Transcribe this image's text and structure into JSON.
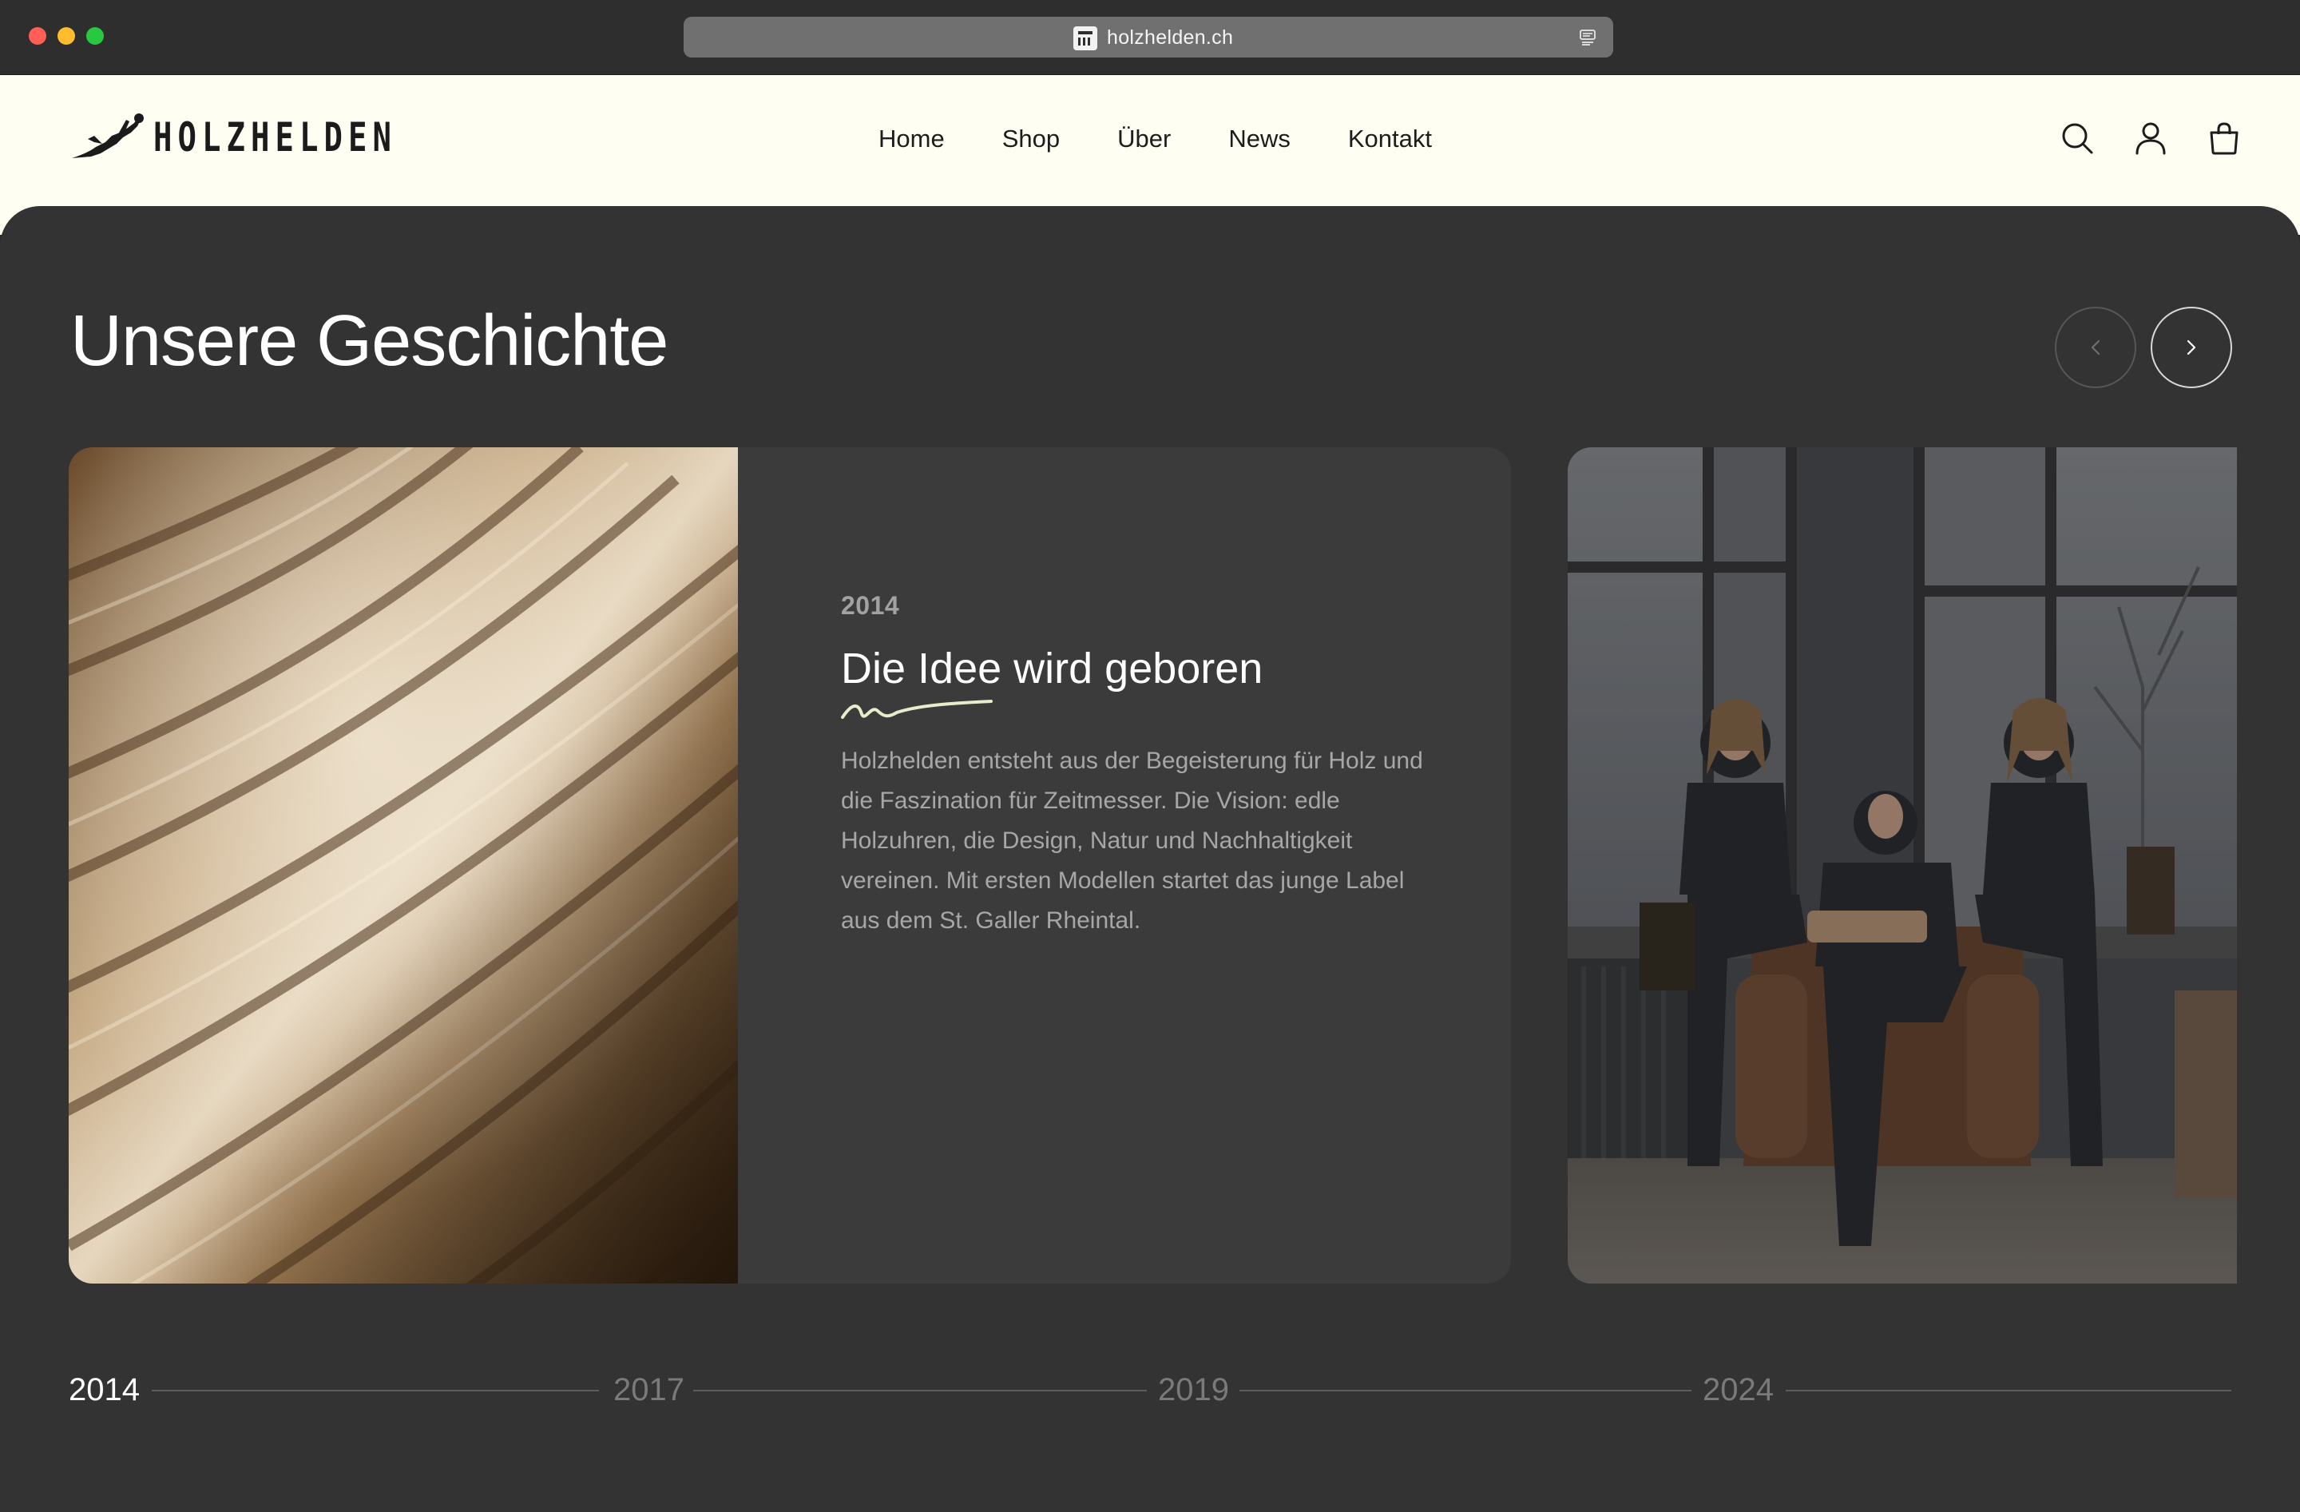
{
  "browser": {
    "url": "holzhelden.ch"
  },
  "header": {
    "logo_text": "HOLZHELDEN",
    "nav": [
      {
        "label": "Home"
      },
      {
        "label": "Shop"
      },
      {
        "label": "Über"
      },
      {
        "label": "News"
      },
      {
        "label": "Kontakt"
      }
    ],
    "icons": [
      "search-icon",
      "account-icon",
      "shopping-bag-icon"
    ]
  },
  "section": {
    "title": "Unsere Geschichte"
  },
  "slide": {
    "year": "2014",
    "heading_highlight": "Die Idee",
    "heading_rest": " wird geboren",
    "text": "Holzhelden entsteht aus der Begeisterung für Holz und die Faszination für Zeitmesser. Die Vision: edle Holzuhren, die Design, Natur und Nachhaltigkeit vereinen. Mit ersten Modellen startet das junge Label aus dem St. Galler Rheintal."
  },
  "timeline": {
    "years": [
      "2014",
      "2017",
      "2019",
      "2024"
    ],
    "active_index": 0
  },
  "colors": {
    "header_bg": "#fefef3",
    "section_bg": "#333333",
    "card_bg": "#3b3b3b",
    "accent_squiggle": "#e9eccb"
  }
}
